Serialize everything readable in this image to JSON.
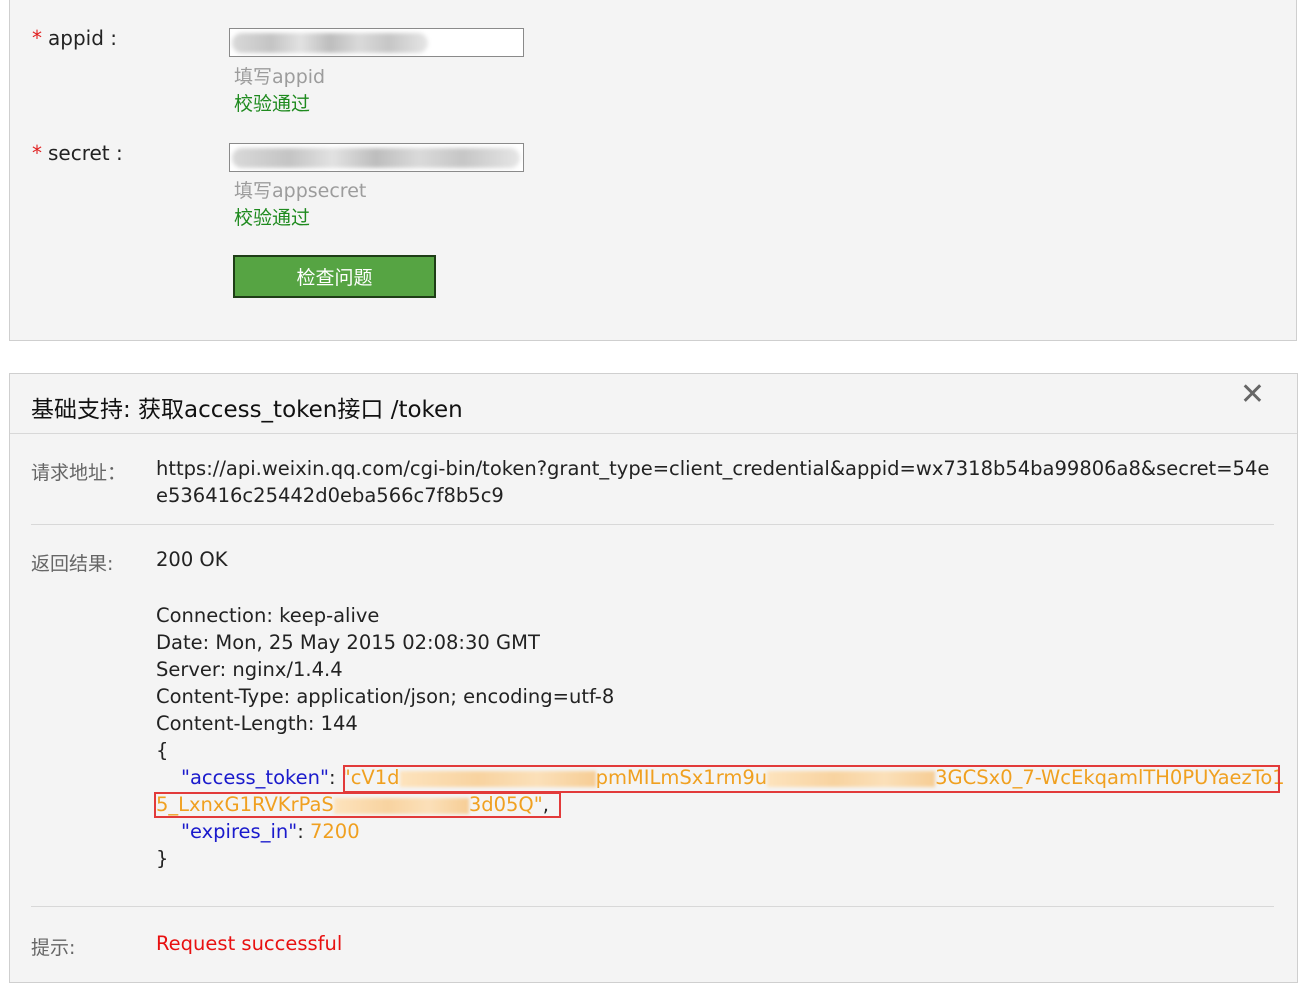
{
  "form": {
    "appid": {
      "required_mark": "*",
      "label": "appid :",
      "value": "",
      "hint": "填写appid",
      "status": "校验通过"
    },
    "secret": {
      "required_mark": "*",
      "label": "secret :",
      "value": "",
      "hint": "填写appsecret",
      "status": "校验通过"
    },
    "submit_label": "检查问题"
  },
  "result": {
    "title": "基础支持: 获取access_token接口 /token",
    "close_icon": "close-icon",
    "request_label": "请求地址：",
    "request_url": "https://api.weixin.qq.com/cgi-bin/token?grant_type=client_credential&appid=wx7318b54ba99806a8&secret=54ee536416c25442d0eba566c7f8b5c9",
    "response_label": "返回结果:",
    "status_line": "200 OK",
    "headers": [
      "Connection: keep-alive",
      "Date: Mon, 25 May 2015 02:08:30 GMT",
      "Server: nginx/1.4.4",
      "Content-Type: application/json; encoding=utf-8",
      "Content-Length: 144"
    ],
    "json_open": "{",
    "json_close": "}",
    "access_token_key": "\"access_token\"",
    "access_token_part1": "cV1d",
    "access_token_part2": "pmMILmSx1rm9u",
    "access_token_part3": "3GCSx0_7-WcEkqamlTH0PUYaezTo1",
    "access_token_part4": "5_LxnxG1RVKrPaS",
    "access_token_part5": "3d05Q",
    "expires_in_key": "\"expires_in\"",
    "expires_in_value": "7200",
    "tip_label": "提示:",
    "tip_text": "Request successful"
  },
  "colors": {
    "button_green": "#56a443",
    "ok_green": "#1e8a1e",
    "json_key_blue": "#1a1acc",
    "json_value_orange": "#f0a020",
    "success_red": "#e81010",
    "highlight_red": "#e23a3a"
  }
}
